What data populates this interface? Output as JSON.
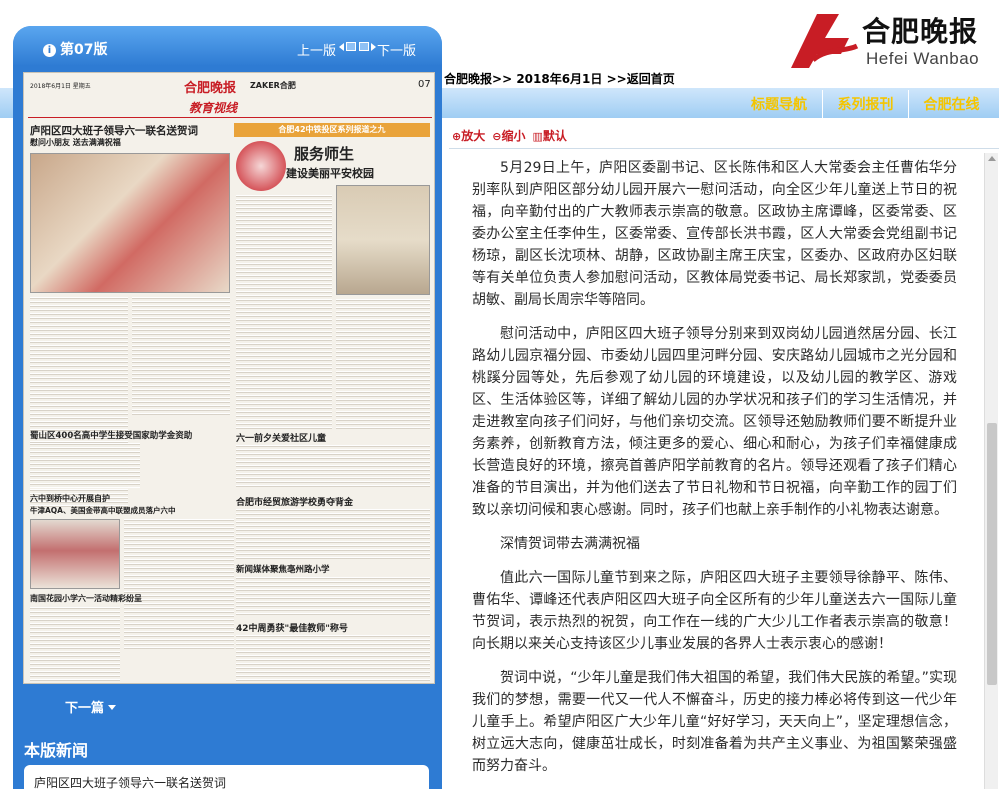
{
  "left_panel": {
    "edition_label": "第07版",
    "prev_page": "上一版",
    "next_page": "下一版",
    "next_article": "下一篇",
    "section_title": "本版新闻",
    "news_items": [
      "庐阳区四大班子领导六一联名送贺词"
    ]
  },
  "newspaper": {
    "masthead": "合肥晚报",
    "zaker": "ZAKER合肥",
    "page_no": "07",
    "section_name": "教育视线",
    "date_line": "2018年6月1日 星期五",
    "headline_1": "庐阳区四大班子领导六一联名送贺词",
    "subhead_1": "慰问小朋友 送去满满祝福",
    "banner": "合肥42中铁投区系列报道之九",
    "headline_2": "服务师生",
    "headline_2b": "建设美丽平安校园",
    "headline_3": "蜀山区400名高中学生接受国家助学金资助",
    "headline_4": "六一前夕关爱社区儿童",
    "headline_5": "六中到桥中心开展自护",
    "headline_6": "合肥市经贸旅游学校勇夺背金",
    "headline_7": "新闻媒体聚焦亳州路小学",
    "headline_8": "南国花园小学六一活动精彩纷呈",
    "headline_9": "42中周勇获\"最佳教师\"称号",
    "headline_10": "牛津AQA、美国金带高中联盟成员落户六中"
  },
  "breadcrumb": {
    "home": "合肥晚报",
    "sep": ">>",
    "date": "2018年6月1日",
    "back": "返回首页"
  },
  "logo": {
    "cn": "合肥晚报",
    "en": "Hefei Wanbao"
  },
  "topnav": [
    "标题导航",
    "系列报刊",
    "合肥在线"
  ],
  "toolbar": {
    "zoom_in": "放大",
    "zoom_out": "缩小",
    "default": "默认"
  },
  "article": {
    "paragraphs": [
      "5月29日上午，庐阳区委副书记、区长陈伟和区人大常委会主任曹佑华分别率队到庐阳区部分幼儿园开展六一慰问活动，向全区少年儿童送上节日的祝福，向辛勤付出的广大教师表示崇高的敬意。区政协主席谭峰，区委常委、区委办公室主任李仲生，区委常委、宣传部长洪书霞，区人大常委会党组副书记杨琼，副区长沈项林、胡静，区政协副主席王庆宝，区委办、区政府办区妇联等有关单位负责人参加慰问活动，区教体局党委书记、局长郑家凯，党委委员胡敏、副局长周宗华等陪同。",
      "慰问活动中，庐阳区四大班子领导分别来到双岗幼儿园逍然居分园、长江路幼儿园京福分园、市委幼儿园四里河畔分园、安庆路幼儿园城市之光分园和桃蹊分园等处，先后参观了幼儿园的环境建设，以及幼儿园的教学区、游戏区、生活体验区等，详细了解幼儿园的办学状况和孩子们的学习生活情况，并走进教室向孩子们问好，与他们亲切交流。区领导还勉励教师们要不断提升业务素养，创新教育方法，倾注更多的爱心、细心和耐心，为孩子们幸福健康成长营造良好的环境，擦亮首善庐阳学前教育的名片。领导还观看了孩子们精心准备的节目演出，并为他们送去了节日礼物和节日祝福，向辛勤工作的园丁们致以亲切问候和衷心感谢。同时，孩子们也献上亲手制作的小礼物表达谢意。",
      "深情贺词带去满满祝福",
      "值此六一国际儿童节到来之际，庐阳区四大班子主要领导徐静平、陈伟、曹佑华、谭峰还代表庐阳区四大班子向全区所有的少年儿童送去六一国际儿童节贺词，表示热烈的祝贺，向工作在一线的广大少儿工作者表示崇高的敬意！向长期以来关心支持该区少儿事业发展的各界人士表示衷心的感谢！",
      "贺词中说，“少年儿童是我们伟大祖国的希望，我们伟大民族的希望。”实现我们的梦想，需要一代又一代人不懈奋斗，历史的接力棒必将传到这一代少年儿童手上。希望庐阳区广大少年儿童“好好学习，天天向上”，坚定理想信念，树立远大志向，健康茁壮成长，时刻准备着为共产主义事业、为祖国繁荣强盛而努力奋斗。"
    ]
  },
  "colors": {
    "panel_blue": "#2e7bd3",
    "nav_gold": "#f4c500",
    "accent_red": "#c81d25"
  }
}
